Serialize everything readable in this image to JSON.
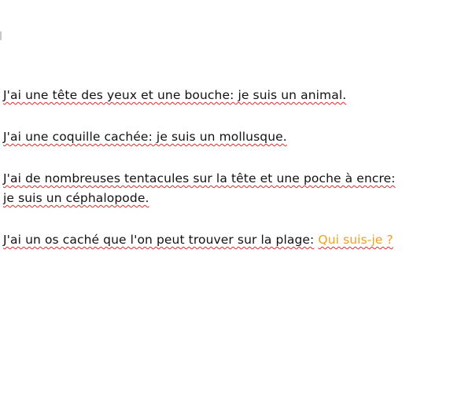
{
  "document": {
    "paragraphs": [
      {
        "lines": [
          "J'ai une tête des yeux et une bouche: je suis un animal."
        ]
      },
      {
        "lines": [
          "J'ai une coquille cachée: je suis un mollusque."
        ]
      },
      {
        "lines": [
          "J'ai de nombreuses tentacules sur la tête et une poche à encre:",
          "je suis un céphalopode."
        ]
      },
      {
        "lines": [
          "J'ai un os caché que l'on peut trouver sur la plage:"
        ],
        "question": "Qui suis-je ?"
      }
    ]
  },
  "colors": {
    "text": "#111111",
    "question": "#f0a020",
    "spellcheck_underline": "#e02a2a"
  }
}
